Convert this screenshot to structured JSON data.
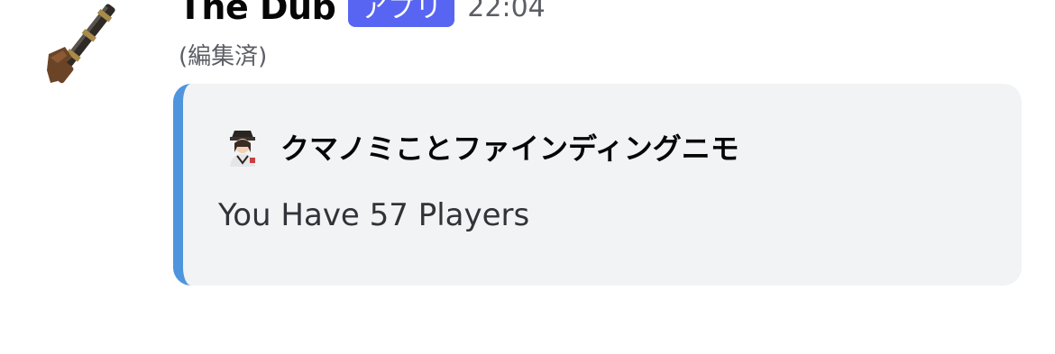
{
  "message": {
    "avatar_icon": "shotgun-icon",
    "username": "The Dub",
    "app_badge": "アプリ",
    "timestamp": "22:04",
    "edited_label": "(編集済)",
    "embed": {
      "accent_color": "#4e95de",
      "author_icon": "character-avatar-icon",
      "author_name": "クマノミことファインディングニモ",
      "description": "You Have 57 Players"
    }
  },
  "colors": {
    "app_badge": "#5865f2",
    "embed_background": "#f2f3f5"
  }
}
